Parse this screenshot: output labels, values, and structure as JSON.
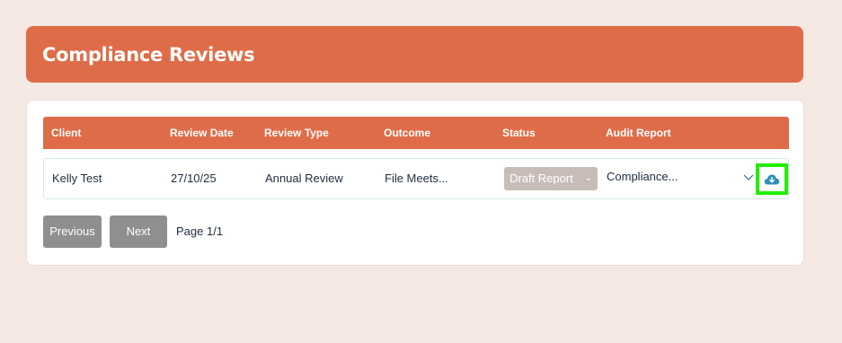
{
  "header": {
    "title": "Compliance Reviews"
  },
  "table": {
    "columns": [
      "Client",
      "Review Date",
      "Review Type",
      "Outcome",
      "Status",
      "Audit Report"
    ],
    "rows": [
      {
        "client": "Kelly Test",
        "review_date": "27/10/25",
        "review_type": "Annual Review",
        "outcome": "File Meets...",
        "status": "Draft Report",
        "audit_report": "Compliance..."
      }
    ]
  },
  "pagination": {
    "previous_label": "Previous",
    "next_label": "Next",
    "page_info": "Page 1/1"
  },
  "colors": {
    "accent": "#df6c48",
    "page_bg": "#f6e8e3",
    "highlight": "#22ee00",
    "download_icon": "#2d8fb5"
  },
  "icons": [
    "chevron-down-icon",
    "cloud-download-icon"
  ]
}
